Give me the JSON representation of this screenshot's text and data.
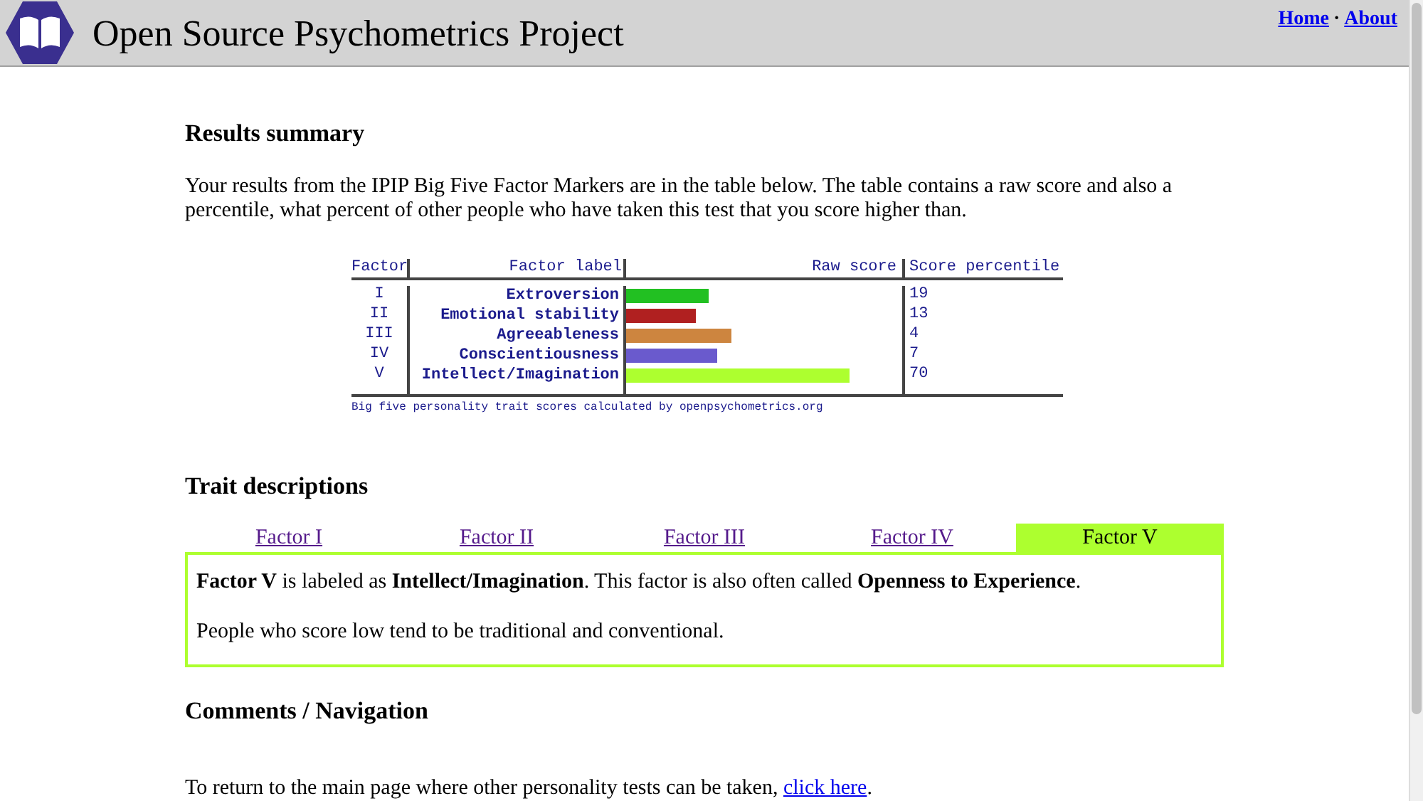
{
  "header": {
    "title": "Open Source Psychometrics Project",
    "links": [
      "Home",
      "About"
    ],
    "separator": "·"
  },
  "summary": {
    "heading": "Results summary",
    "text": "Your results from the IPIP Big Five Factor Markers are in the table below. The table contains a raw score and also a percentile, what percent of other people who have taken this test that you score higher than."
  },
  "table": {
    "columns": [
      "Factor",
      "Factor label",
      "Raw score",
      "Score percentile"
    ],
    "rows": [
      {
        "factor": "I",
        "label": "Extroversion",
        "level": 0.3,
        "color": "#22c022",
        "percentile": "19"
      },
      {
        "factor": "II",
        "label": "Emotional stability",
        "level": 0.25,
        "color": "#b02020",
        "percentile": "13"
      },
      {
        "factor": "III",
        "label": "Agreeableness",
        "level": 0.38,
        "color": "#cd853f",
        "percentile": "4"
      },
      {
        "factor": "IV",
        "label": "Conscientiousness",
        "level": 0.33,
        "color": "#6a5acd",
        "percentile": "7"
      },
      {
        "factor": "V",
        "label": "Intellect/Imagination",
        "level": 0.81,
        "color": "#adff2f",
        "percentile": "70"
      }
    ],
    "caption": "Big five personality trait scores calculated by openpsychometrics.org"
  },
  "traits": {
    "heading": "Trait descriptions",
    "tabs": [
      {
        "label": "Factor I",
        "selected": false
      },
      {
        "label": "Factor II",
        "selected": false
      },
      {
        "label": "Factor III",
        "selected": false
      },
      {
        "label": "Factor IV",
        "selected": false
      },
      {
        "label": "Factor V",
        "selected": true
      }
    ],
    "paragraphs": [
      "**Factor V** is labeled as **Intellect/Imagination**. This factor is also often called **Openness to Experience**.",
      "People who score low tend to be traditional and conventional."
    ]
  },
  "comments": {
    "heading": "Comments / Navigation",
    "text": "To return to the main page where other personality tests can be taken,",
    "link": "click here",
    "end": "."
  }
}
